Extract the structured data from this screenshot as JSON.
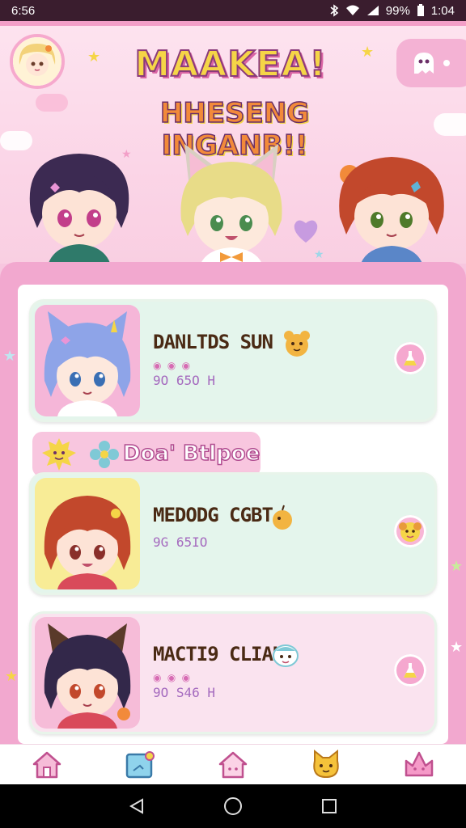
{
  "status_bar": {
    "time": "6:56",
    "battery": "99%",
    "clock": "1:04"
  },
  "header": {
    "title_line1": "MAAKEA!",
    "title_line2": "HHESENG INGANB!!"
  },
  "cards": [
    {
      "name": "DANLTDS SUN",
      "meta": "9O 65O H",
      "dots": "◉ ◉ ◉"
    },
    {
      "name": "MEDODG CGBT",
      "meta": "9G 65IO",
      "dots": ""
    },
    {
      "name": "MACTI9 CLIAN",
      "meta": "9O S46 H",
      "dots": "◉ ◉ ◉"
    }
  ],
  "section_tag": {
    "label": "Doa' Btlpoe"
  },
  "colors": {
    "accent": "#f2a8cf",
    "header_bg": "#fde3ef",
    "status_bg": "#3a1d2e"
  },
  "nav": {
    "items": [
      "home-icon",
      "photo-edit-icon",
      "house-icon",
      "cat-face-icon",
      "crown-icon"
    ]
  }
}
